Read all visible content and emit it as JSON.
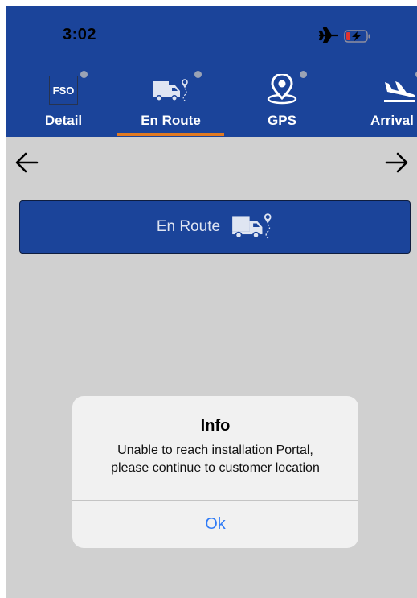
{
  "status_bar": {
    "time": "3:02",
    "icons": [
      "airplane-icon",
      "battery-charging-icon"
    ]
  },
  "tabs": [
    {
      "label": "Detail",
      "icon": "fso-icon",
      "icon_text": "FSO"
    },
    {
      "label": "En Route",
      "icon": "truck-route-icon",
      "selected": true
    },
    {
      "label": "GPS",
      "icon": "location-pin-icon"
    },
    {
      "label": "Arrival",
      "icon": "plane-landing-icon"
    }
  ],
  "nav": {
    "back_icon": "arrow-left-icon",
    "forward_icon": "arrow-right-icon"
  },
  "main": {
    "enroute_button_label": "En Route"
  },
  "dialog": {
    "title": "Info",
    "message_line1": "Unable to reach installation Portal,",
    "message_line2": "please continue to customer location",
    "ok_label": "Ok"
  },
  "colors": {
    "header": "#1b449a",
    "background": "#d0d0d0",
    "tab_indicator": "#e07a22",
    "link_blue": "#2f7bf6"
  }
}
